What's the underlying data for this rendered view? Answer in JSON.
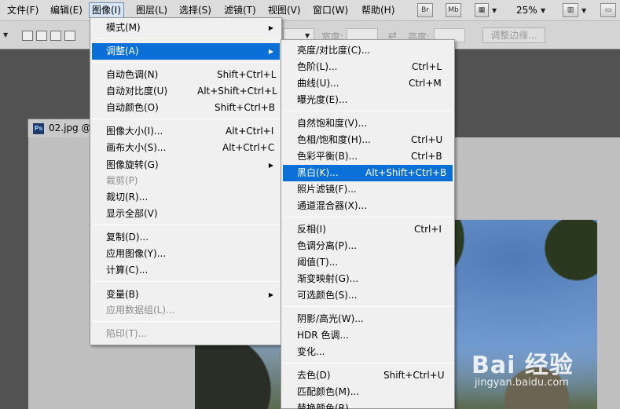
{
  "menubar": {
    "items": [
      "文件(F)",
      "编辑(E)",
      "图像(I)",
      "图层(L)",
      "选择(S)",
      "滤镜(T)",
      "视图(V)",
      "窗口(W)",
      "帮助(H)"
    ],
    "br_label": "Br",
    "mb_label": "Mb",
    "zoom": "25%"
  },
  "options": {
    "width_label": "宽度:",
    "height_label": "高度:",
    "refine_edge": "调整边缘..."
  },
  "document": {
    "tab_title": "02.jpg @",
    "ps_label": "Ps"
  },
  "watermark": {
    "brand": "Bai 经验",
    "url": "jingyan.baidu.com"
  },
  "image_menu": {
    "items": [
      {
        "label": "模式(M)",
        "shortcut": ""
      },
      {
        "label": "调整(A)",
        "shortcut": ""
      },
      {
        "label": "自动色调(N)",
        "shortcut": "Shift+Ctrl+L"
      },
      {
        "label": "自动对比度(U)",
        "shortcut": "Alt+Shift+Ctrl+L"
      },
      {
        "label": "自动颜色(O)",
        "shortcut": "Shift+Ctrl+B"
      },
      {
        "label": "图像大小(I)...",
        "shortcut": "Alt+Ctrl+I"
      },
      {
        "label": "画布大小(S)...",
        "shortcut": "Alt+Ctrl+C"
      },
      {
        "label": "图像旋转(G)",
        "shortcut": ""
      },
      {
        "label": "裁剪(P)",
        "shortcut": ""
      },
      {
        "label": "裁切(R)...",
        "shortcut": ""
      },
      {
        "label": "显示全部(V)",
        "shortcut": ""
      },
      {
        "label": "复制(D)...",
        "shortcut": ""
      },
      {
        "label": "应用图像(Y)...",
        "shortcut": ""
      },
      {
        "label": "计算(C)...",
        "shortcut": ""
      },
      {
        "label": "变量(B)",
        "shortcut": ""
      },
      {
        "label": "应用数据组(L)...",
        "shortcut": ""
      },
      {
        "label": "陷印(T)...",
        "shortcut": ""
      }
    ]
  },
  "adjust_menu": {
    "items": [
      {
        "label": "亮度/对比度(C)...",
        "shortcut": ""
      },
      {
        "label": "色阶(L)...",
        "shortcut": "Ctrl+L"
      },
      {
        "label": "曲线(U)...",
        "shortcut": "Ctrl+M"
      },
      {
        "label": "曝光度(E)...",
        "shortcut": ""
      },
      {
        "label": "自然饱和度(V)...",
        "shortcut": ""
      },
      {
        "label": "色相/饱和度(H)...",
        "shortcut": "Ctrl+U"
      },
      {
        "label": "色彩平衡(B)...",
        "shortcut": "Ctrl+B"
      },
      {
        "label": "黑白(K)...",
        "shortcut": "Alt+Shift+Ctrl+B"
      },
      {
        "label": "照片滤镜(F)...",
        "shortcut": ""
      },
      {
        "label": "通道混合器(X)...",
        "shortcut": ""
      },
      {
        "label": "反相(I)",
        "shortcut": "Ctrl+I"
      },
      {
        "label": "色调分离(P)...",
        "shortcut": ""
      },
      {
        "label": "阈值(T)...",
        "shortcut": ""
      },
      {
        "label": "渐变映射(G)...",
        "shortcut": ""
      },
      {
        "label": "可选颜色(S)...",
        "shortcut": ""
      },
      {
        "label": "阴影/高光(W)...",
        "shortcut": ""
      },
      {
        "label": "HDR 色调...",
        "shortcut": ""
      },
      {
        "label": "变化...",
        "shortcut": ""
      },
      {
        "label": "去色(D)",
        "shortcut": "Shift+Ctrl+U"
      },
      {
        "label": "匹配颜色(M)...",
        "shortcut": ""
      },
      {
        "label": "替换颜色(R)...",
        "shortcut": ""
      }
    ]
  }
}
